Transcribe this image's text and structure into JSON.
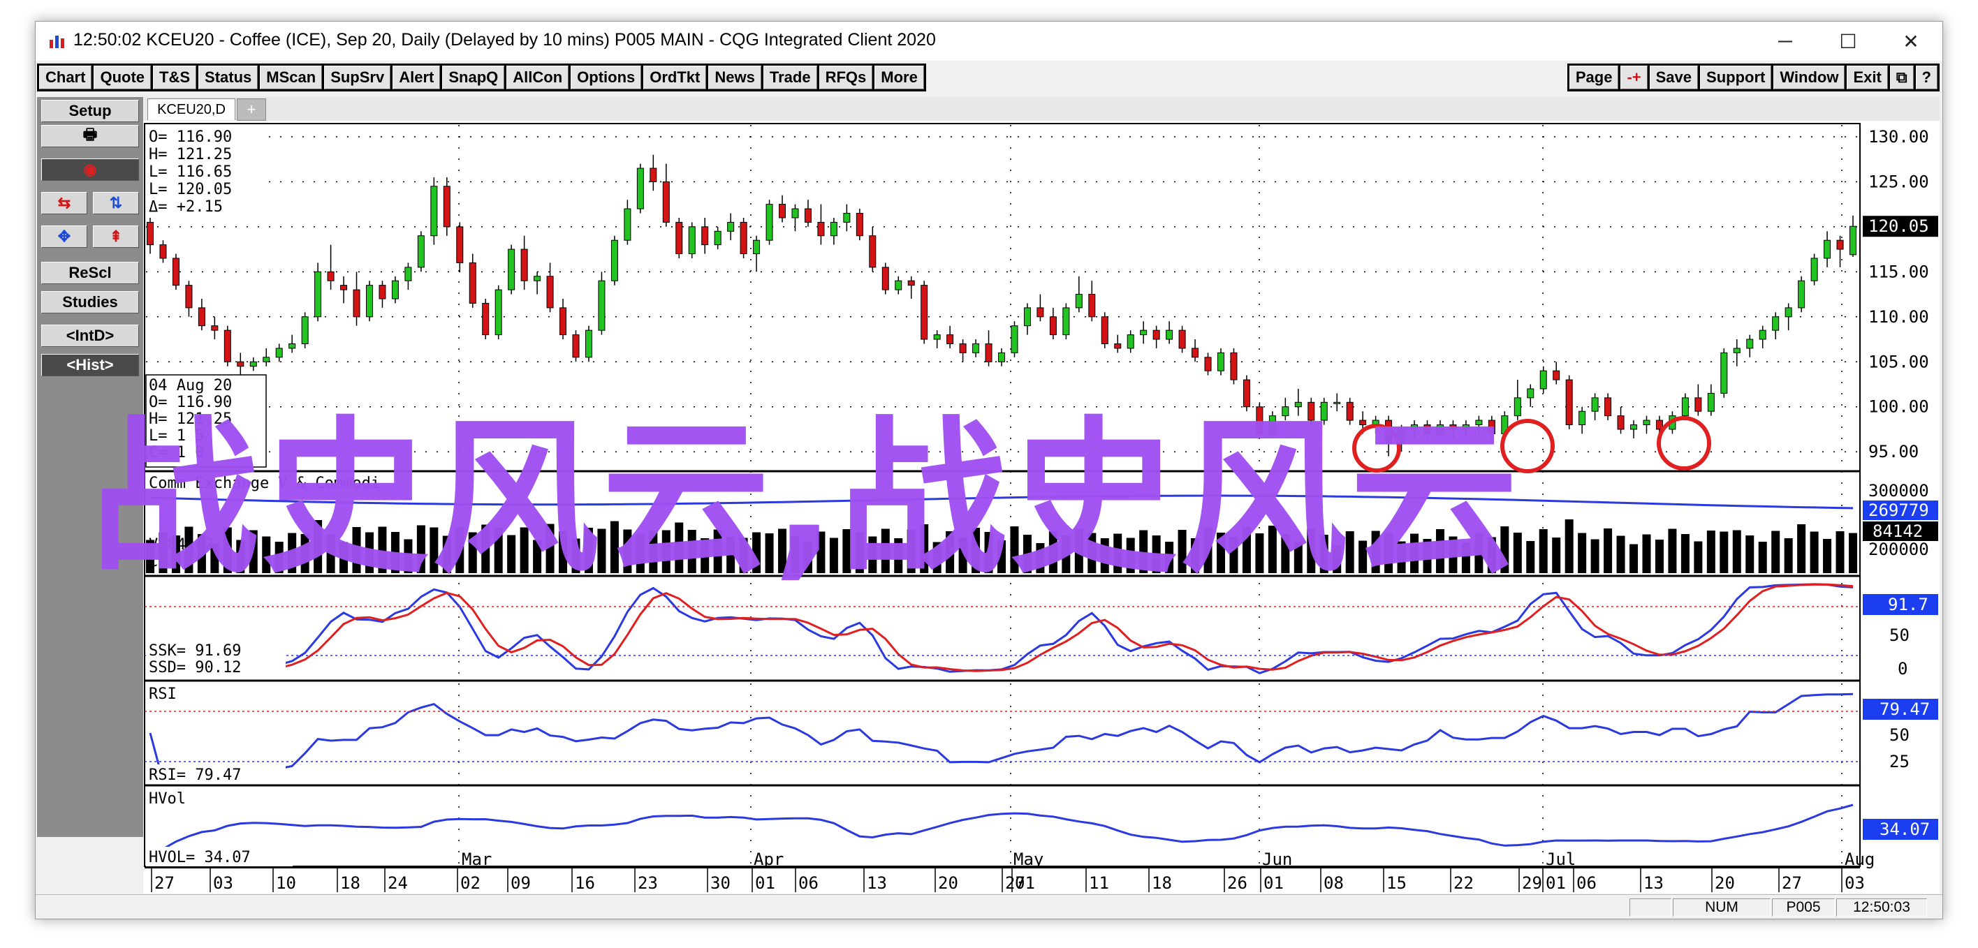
{
  "window": {
    "title": "12:50:02   KCEU20 - Coffee (ICE), Sep 20, Daily (Delayed by 10 mins)    P005 MAIN - CQG Integrated Client 2020",
    "minimize": "─",
    "maximize": "☐",
    "close": "✕"
  },
  "toolbar": {
    "left": [
      "Chart",
      "Quote",
      "T&S",
      "Status",
      "MScan",
      "SupSrv",
      "Alert",
      "SnapQ",
      "AllCon",
      "Options",
      "OrdTkt",
      "News",
      "Trade",
      "RFQs",
      "More"
    ],
    "right": [
      "Page",
      "-+",
      "Save",
      "Support",
      "Window",
      "Exit",
      "⧉",
      "?"
    ]
  },
  "sidebar": {
    "setup": "Setup",
    "print_icon": "printer-icon",
    "icons_row1": [
      "⇆",
      "⇅"
    ],
    "icons_row2": [
      "✥",
      "⇞"
    ],
    "rescl": "ReScl",
    "studies": "Studies",
    "intd": "<IntD>",
    "hist": "<Hist>"
  },
  "tabs": {
    "active": "KCEU20,D",
    "add": "+"
  },
  "ohlc_box": {
    "o": "O=  116.90",
    "h": "H=  121.25",
    "l": "L=  116.65",
    "c": "L=  120.05",
    "d": "Δ=   +2.15"
  },
  "cursor_box": {
    "date": "04 Aug 20",
    "o": "O=   116.90",
    "h": "H=   121.25",
    "l": "L=   1    5",
    "c": "C=   1    0"
  },
  "price_axis": [
    "130.00",
    "125.00",
    "120.05",
    "115.00",
    "110.00",
    "105.00",
    "100.00",
    "95.00"
  ],
  "last_price": "120.05",
  "volume_panel": {
    "label": "Comm    Exchange V   & Commodi",
    "v_label": "V       84142",
    "c_label": "C",
    "axis": [
      "300000",
      "269779",
      "84142",
      "200000"
    ],
    "oi_value": "269779",
    "vol_value": "84142"
  },
  "stoch_panel": {
    "ssk": "SSK=    91.69",
    "ssd": "SSD=    90.12",
    "axis": [
      "91.7",
      "50",
      "0"
    ]
  },
  "rsi_panel": {
    "label": "RSI",
    "value_label": "RSI=    79.47",
    "axis": [
      "79.47",
      "50",
      "25"
    ]
  },
  "hvol_panel": {
    "label": "HVol",
    "value_label": "HVOL=    34.07",
    "axis": [
      "34.07"
    ]
  },
  "time_axis": {
    "months": [
      "Mar",
      "Apr",
      "May",
      "Jun",
      "Jul",
      "Aug"
    ],
    "days": [
      "27",
      "03",
      "10",
      "18",
      "24",
      "02",
      "09",
      "16",
      "23",
      "30",
      "01",
      "06",
      "13",
      "20",
      "27",
      "01",
      "11",
      "18",
      "26",
      "01",
      "08",
      "15",
      "22",
      "29",
      "01",
      "06",
      "13",
      "20",
      "27",
      "03"
    ]
  },
  "statusbar": {
    "num": "NUM",
    "account": "P005",
    "time": "12:50:03"
  },
  "watermark": "战史风云,战史风云",
  "colors": {
    "up": "#22c422",
    "down": "#d41414",
    "blue": "#2a3ae0",
    "red": "#e02020",
    "accent_box": "#1b3ff0"
  },
  "chart_data": {
    "type": "candlestick",
    "ylim": [
      93,
      131
    ],
    "candles": [
      {
        "o": 120.5,
        "h": 121,
        "l": 117,
        "c": 118
      },
      {
        "o": 118,
        "h": 118.5,
        "l": 116,
        "c": 116.5
      },
      {
        "o": 116.5,
        "h": 117,
        "l": 113,
        "c": 113.5
      },
      {
        "o": 113.5,
        "h": 114,
        "l": 110,
        "c": 111
      },
      {
        "o": 111,
        "h": 112,
        "l": 108.5,
        "c": 109
      },
      {
        "o": 109,
        "h": 110,
        "l": 107.5,
        "c": 108.5
      },
      {
        "o": 108.5,
        "h": 109,
        "l": 104.5,
        "c": 105
      },
      {
        "o": 105,
        "h": 106,
        "l": 103.5,
        "c": 104.5
      },
      {
        "o": 104.5,
        "h": 105.5,
        "l": 104,
        "c": 105
      },
      {
        "o": 105,
        "h": 106.5,
        "l": 104.5,
        "c": 105.5
      },
      {
        "o": 105.5,
        "h": 107,
        "l": 105,
        "c": 106.5
      },
      {
        "o": 106.5,
        "h": 108,
        "l": 106,
        "c": 107
      },
      {
        "o": 107,
        "h": 110.5,
        "l": 106.5,
        "c": 110
      },
      {
        "o": 110,
        "h": 116,
        "l": 109.5,
        "c": 115
      },
      {
        "o": 115,
        "h": 118,
        "l": 113,
        "c": 114
      },
      {
        "o": 113.5,
        "h": 114.5,
        "l": 111.5,
        "c": 113
      },
      {
        "o": 113,
        "h": 115,
        "l": 109,
        "c": 110
      },
      {
        "o": 110,
        "h": 114,
        "l": 109.5,
        "c": 113.5
      },
      {
        "o": 113.5,
        "h": 114,
        "l": 111,
        "c": 112
      },
      {
        "o": 112,
        "h": 114.5,
        "l": 111.5,
        "c": 114
      },
      {
        "o": 114,
        "h": 116,
        "l": 113,
        "c": 115.5
      },
      {
        "o": 115.5,
        "h": 119.5,
        "l": 115,
        "c": 119
      },
      {
        "o": 119,
        "h": 125.5,
        "l": 118,
        "c": 124.5
      },
      {
        "o": 124.5,
        "h": 125.5,
        "l": 119,
        "c": 120
      },
      {
        "o": 120,
        "h": 120.5,
        "l": 115,
        "c": 116
      },
      {
        "o": 116,
        "h": 117,
        "l": 111,
        "c": 111.5
      },
      {
        "o": 111.5,
        "h": 112,
        "l": 107.5,
        "c": 108
      },
      {
        "o": 108,
        "h": 113.5,
        "l": 107.5,
        "c": 113
      },
      {
        "o": 113,
        "h": 118,
        "l": 112.5,
        "c": 117.5
      },
      {
        "o": 117.5,
        "h": 119,
        "l": 113,
        "c": 114
      },
      {
        "o": 114,
        "h": 115,
        "l": 112.5,
        "c": 114.5
      },
      {
        "o": 114.5,
        "h": 116,
        "l": 110.5,
        "c": 111
      },
      {
        "o": 111,
        "h": 112,
        "l": 107.5,
        "c": 108
      },
      {
        "o": 108,
        "h": 108.5,
        "l": 105,
        "c": 105.5
      },
      {
        "o": 105.5,
        "h": 109,
        "l": 105,
        "c": 108.5
      },
      {
        "o": 108.5,
        "h": 115,
        "l": 108,
        "c": 114
      },
      {
        "o": 114,
        "h": 119,
        "l": 113.5,
        "c": 118.5
      },
      {
        "o": 118.5,
        "h": 123,
        "l": 118,
        "c": 122
      },
      {
        "o": 122,
        "h": 127,
        "l": 121.5,
        "c": 126.5
      },
      {
        "o": 126.5,
        "h": 128,
        "l": 124,
        "c": 125
      },
      {
        "o": 125,
        "h": 127,
        "l": 120,
        "c": 120.5
      },
      {
        "o": 120.5,
        "h": 121,
        "l": 116.5,
        "c": 117
      },
      {
        "o": 117,
        "h": 120.5,
        "l": 116.5,
        "c": 120
      },
      {
        "o": 120,
        "h": 121,
        "l": 117,
        "c": 118
      },
      {
        "o": 118,
        "h": 120,
        "l": 117.5,
        "c": 119.5
      },
      {
        "o": 119.5,
        "h": 121.5,
        "l": 118.5,
        "c": 120.5
      },
      {
        "o": 120.5,
        "h": 121,
        "l": 116.5,
        "c": 117
      },
      {
        "o": 117,
        "h": 119,
        "l": 115,
        "c": 118.5
      },
      {
        "o": 118.5,
        "h": 123,
        "l": 118,
        "c": 122.5
      },
      {
        "o": 122.5,
        "h": 123.5,
        "l": 120.5,
        "c": 121
      },
      {
        "o": 121,
        "h": 122.5,
        "l": 119.5,
        "c": 122
      },
      {
        "o": 122,
        "h": 123,
        "l": 120,
        "c": 120.5
      },
      {
        "o": 120.5,
        "h": 122.5,
        "l": 118,
        "c": 119
      },
      {
        "o": 119,
        "h": 121,
        "l": 118,
        "c": 120.5
      },
      {
        "o": 120.5,
        "h": 122.5,
        "l": 119.5,
        "c": 121.5
      },
      {
        "o": 121.5,
        "h": 122,
        "l": 118.5,
        "c": 119
      },
      {
        "o": 119,
        "h": 120,
        "l": 115,
        "c": 115.5
      },
      {
        "o": 115.5,
        "h": 116,
        "l": 112.5,
        "c": 113
      },
      {
        "o": 113,
        "h": 114.5,
        "l": 112.5,
        "c": 114
      },
      {
        "o": 114,
        "h": 114.5,
        "l": 112,
        "c": 113.5
      },
      {
        "o": 113.5,
        "h": 114,
        "l": 107,
        "c": 107.5
      },
      {
        "o": 107.5,
        "h": 108.5,
        "l": 106.5,
        "c": 108
      },
      {
        "o": 108,
        "h": 109,
        "l": 106.5,
        "c": 107
      },
      {
        "o": 107,
        "h": 107.5,
        "l": 105,
        "c": 106
      },
      {
        "o": 106,
        "h": 107.5,
        "l": 105.5,
        "c": 107
      },
      {
        "o": 107,
        "h": 108.5,
        "l": 104.5,
        "c": 105
      },
      {
        "o": 105,
        "h": 106.5,
        "l": 104.5,
        "c": 106
      },
      {
        "o": 106,
        "h": 109.5,
        "l": 105.5,
        "c": 109
      },
      {
        "o": 109,
        "h": 111.5,
        "l": 108,
        "c": 111
      },
      {
        "o": 111,
        "h": 112.5,
        "l": 109.5,
        "c": 110
      },
      {
        "o": 110,
        "h": 111,
        "l": 107.5,
        "c": 108
      },
      {
        "o": 108,
        "h": 111.5,
        "l": 107.5,
        "c": 111
      },
      {
        "o": 111,
        "h": 114.5,
        "l": 110.5,
        "c": 112.5
      },
      {
        "o": 112.5,
        "h": 114,
        "l": 109.5,
        "c": 110
      },
      {
        "o": 110,
        "h": 110.5,
        "l": 106.5,
        "c": 107
      },
      {
        "o": 107,
        "h": 108,
        "l": 106,
        "c": 106.5
      },
      {
        "o": 106.5,
        "h": 108.5,
        "l": 106,
        "c": 108
      },
      {
        "o": 108,
        "h": 109.5,
        "l": 107,
        "c": 108.5
      },
      {
        "o": 108.5,
        "h": 109,
        "l": 106.5,
        "c": 107.5
      },
      {
        "o": 107.5,
        "h": 109.5,
        "l": 107,
        "c": 108.5
      },
      {
        "o": 108.5,
        "h": 109,
        "l": 106,
        "c": 106.5
      },
      {
        "o": 106.5,
        "h": 107.5,
        "l": 105,
        "c": 105.5
      },
      {
        "o": 105.5,
        "h": 106,
        "l": 103.5,
        "c": 104
      },
      {
        "o": 104,
        "h": 106.5,
        "l": 103.5,
        "c": 106
      },
      {
        "o": 106,
        "h": 106.5,
        "l": 102.5,
        "c": 103
      },
      {
        "o": 103,
        "h": 103.5,
        "l": 99.5,
        "c": 100
      },
      {
        "o": 100,
        "h": 100.5,
        "l": 96.5,
        "c": 97
      },
      {
        "o": 97,
        "h": 99.5,
        "l": 96.5,
        "c": 99
      },
      {
        "o": 99,
        "h": 101,
        "l": 98.5,
        "c": 100
      },
      {
        "o": 100,
        "h": 102,
        "l": 99,
        "c": 100.5
      },
      {
        "o": 100.5,
        "h": 101,
        "l": 98,
        "c": 98.5
      },
      {
        "o": 98.5,
        "h": 101,
        "l": 98,
        "c": 100.5
      },
      {
        "o": 100.5,
        "h": 101.5,
        "l": 99.5,
        "c": 100.5
      },
      {
        "o": 100.5,
        "h": 101,
        "l": 98,
        "c": 98.5
      },
      {
        "o": 98.5,
        "h": 99.5,
        "l": 97,
        "c": 98
      },
      {
        "o": 98,
        "h": 99,
        "l": 97,
        "c": 98.5
      },
      {
        "o": 98.5,
        "h": 99,
        "l": 94.5,
        "c": 96
      },
      {
        "o": 96,
        "h": 98,
        "l": 95,
        "c": 97.5
      },
      {
        "o": 97.5,
        "h": 98.5,
        "l": 96.5,
        "c": 98
      },
      {
        "o": 98,
        "h": 98.5,
        "l": 96.5,
        "c": 97
      },
      {
        "o": 97,
        "h": 98.5,
        "l": 96.5,
        "c": 98
      },
      {
        "o": 98,
        "h": 98.5,
        "l": 96.5,
        "c": 97.5
      },
      {
        "o": 97.5,
        "h": 98.5,
        "l": 96.5,
        "c": 98
      },
      {
        "o": 98,
        "h": 99,
        "l": 97,
        "c": 98.5
      },
      {
        "o": 98.5,
        "h": 99,
        "l": 96,
        "c": 97
      },
      {
        "o": 97,
        "h": 99.5,
        "l": 96.5,
        "c": 99
      },
      {
        "o": 99,
        "h": 103,
        "l": 98.5,
        "c": 101
      },
      {
        "o": 101,
        "h": 102.5,
        "l": 100,
        "c": 102
      },
      {
        "o": 102,
        "h": 104.5,
        "l": 101.5,
        "c": 104
      },
      {
        "o": 104,
        "h": 105,
        "l": 102.5,
        "c": 103
      },
      {
        "o": 103,
        "h": 103.5,
        "l": 97.5,
        "c": 98
      },
      {
        "o": 98,
        "h": 100,
        "l": 97,
        "c": 99.5
      },
      {
        "o": 99.5,
        "h": 101.5,
        "l": 98.5,
        "c": 101
      },
      {
        "o": 101,
        "h": 101.5,
        "l": 98.5,
        "c": 99
      },
      {
        "o": 99,
        "h": 100,
        "l": 97,
        "c": 97.5
      },
      {
        "o": 97.5,
        "h": 98.5,
        "l": 96.5,
        "c": 98
      },
      {
        "o": 98,
        "h": 99,
        "l": 97,
        "c": 98.5
      },
      {
        "o": 98.5,
        "h": 99,
        "l": 97,
        "c": 97.5
      },
      {
        "o": 97.5,
        "h": 99.5,
        "l": 97,
        "c": 99
      },
      {
        "o": 99,
        "h": 101.5,
        "l": 98.5,
        "c": 101
      },
      {
        "o": 101,
        "h": 102.5,
        "l": 99,
        "c": 99.5
      },
      {
        "o": 99.5,
        "h": 102.5,
        "l": 99,
        "c": 101.5
      },
      {
        "o": 101.5,
        "h": 106.5,
        "l": 101,
        "c": 106
      },
      {
        "o": 106,
        "h": 107.5,
        "l": 104.5,
        "c": 106.5
      },
      {
        "o": 106.5,
        "h": 108,
        "l": 105.5,
        "c": 107.5
      },
      {
        "o": 107.5,
        "h": 109,
        "l": 106.5,
        "c": 108.5
      },
      {
        "o": 108.5,
        "h": 110.5,
        "l": 107.5,
        "c": 110
      },
      {
        "o": 110,
        "h": 111.5,
        "l": 108.5,
        "c": 111
      },
      {
        "o": 111,
        "h": 114.5,
        "l": 110.5,
        "c": 114
      },
      {
        "o": 114,
        "h": 117,
        "l": 113.5,
        "c": 116.5
      },
      {
        "o": 116.5,
        "h": 119.5,
        "l": 115.5,
        "c": 118.5
      },
      {
        "o": 118.5,
        "h": 119,
        "l": 115.5,
        "c": 117.5
      },
      {
        "o": 116.9,
        "h": 121.25,
        "l": 116.65,
        "c": 120.05
      }
    ]
  }
}
